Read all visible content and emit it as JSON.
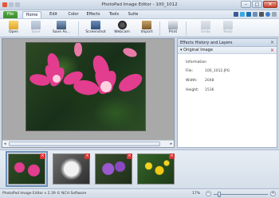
{
  "window": {
    "title": "PhotoPad Image Editor - 100_1012"
  },
  "menu": {
    "items": [
      "File",
      "Home",
      "Edit",
      "Color",
      "Effects",
      "Tools",
      "Suite"
    ],
    "active": "Home"
  },
  "toolbar": {
    "tools": [
      {
        "label": "Open",
        "enabled": true,
        "icon": "open-folder-icon"
      },
      {
        "label": "Save",
        "enabled": false,
        "icon": "save-icon"
      },
      {
        "label": "Save As...",
        "enabled": true,
        "icon": "save-as-icon"
      },
      {
        "label": "Screenshot",
        "enabled": true,
        "icon": "screenshot-icon"
      },
      {
        "label": "Webcam",
        "enabled": true,
        "icon": "webcam-icon"
      },
      {
        "label": "Import",
        "enabled": true,
        "icon": "import-icon"
      },
      {
        "label": "Print",
        "enabled": true,
        "icon": "print-icon"
      },
      {
        "label": "Undo",
        "enabled": false,
        "icon": "undo-icon"
      },
      {
        "label": "Redo",
        "enabled": false,
        "icon": "redo-icon"
      }
    ]
  },
  "panel": {
    "title": "Effects History and Layers",
    "layer": "Original Image",
    "info_title": "Information",
    "info": [
      {
        "key": "File:",
        "value": "100_1012.JPG"
      },
      {
        "key": "Width:",
        "value": "2048"
      },
      {
        "key": "Height:",
        "value": "1536"
      }
    ]
  },
  "filmstrip": {
    "thumbnails": [
      "pink-flowers",
      "white-flower",
      "purple-flowers",
      "yellow-flowers"
    ],
    "selected_index": 0
  },
  "status": {
    "text": "PhotoPad Image Editor v 2.39 © NCH Software",
    "zoom": "17%"
  },
  "colors": {
    "file_tab": "#3a8a2a",
    "ribbon_bg": "#dfe7f1",
    "close_button": "#c9452f",
    "thumb_close": "#dd3333"
  }
}
